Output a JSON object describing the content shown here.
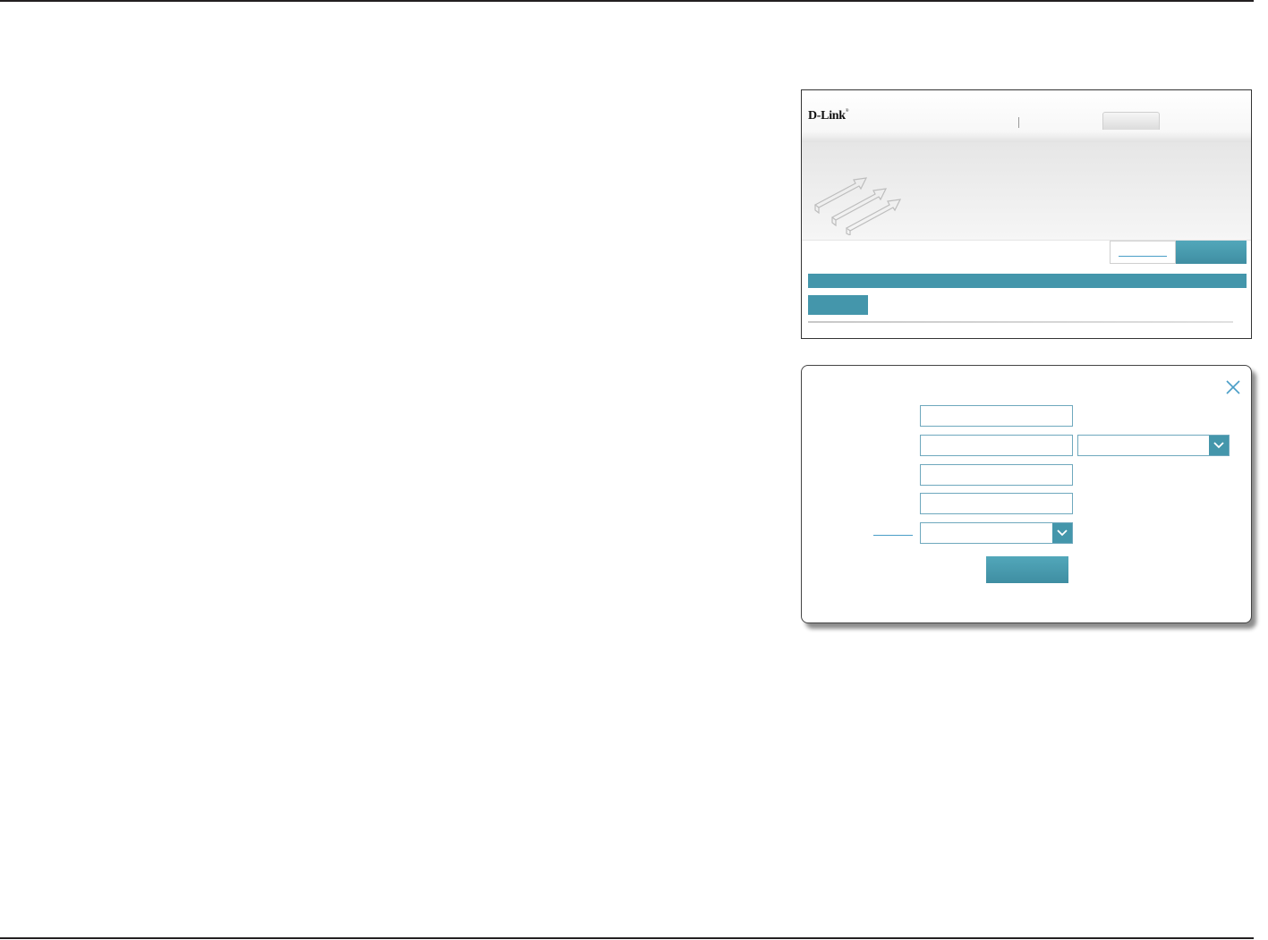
{
  "router_ui": {
    "logo_text": "D-Link",
    "logo_trademark": "®",
    "icons": {
      "hero": "stacked-arrows-icon"
    }
  },
  "dialog": {
    "icons": {
      "close": "close-icon",
      "dropdown": "chevron-down-icon"
    },
    "fields": {
      "field_1": "",
      "field_2": "",
      "select_1": "",
      "field_3": "",
      "field_4": "",
      "select_2": ""
    }
  },
  "colors": {
    "accent_teal": "#4496ab",
    "border_teal": "#6ea8bd",
    "link_blue": "#4a9ec7"
  }
}
